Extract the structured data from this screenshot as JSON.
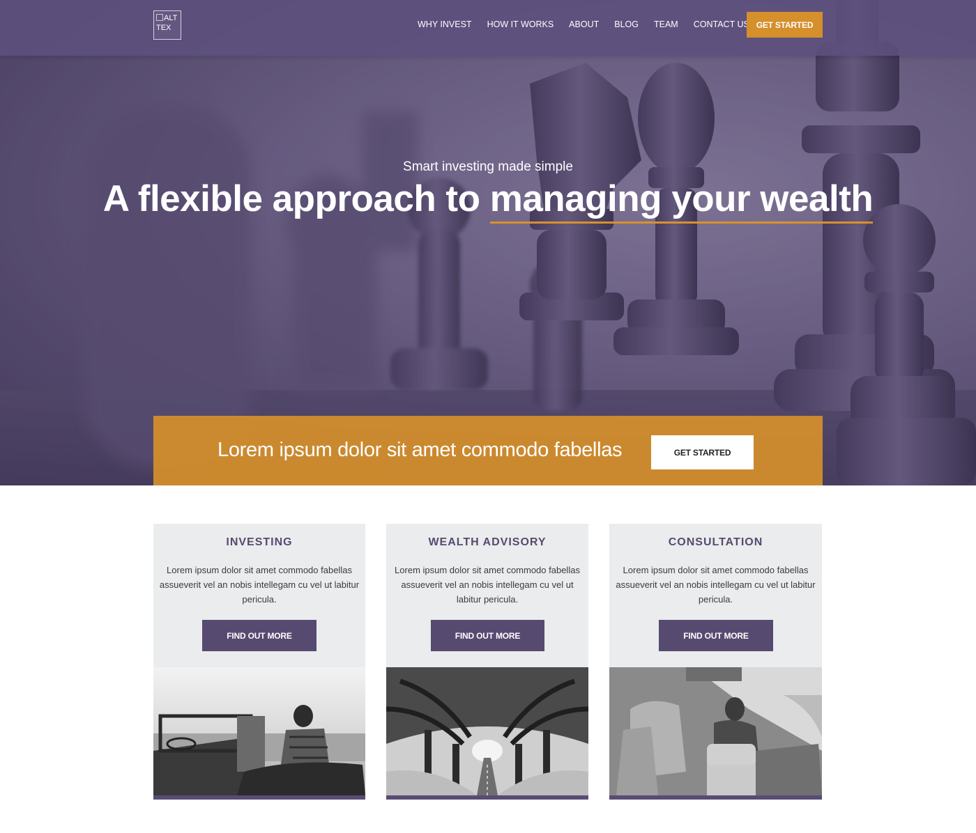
{
  "header": {
    "logo_alt": "ALT TEX",
    "nav": [
      "WHY INVEST",
      "HOW IT WORKS",
      "ABOUT",
      "BLOG",
      "TEAM",
      "CONTACT US"
    ],
    "cta": "GET STARTED"
  },
  "hero": {
    "subtitle": "Smart investing made simple",
    "title_lead": "A flexible approach to ",
    "title_highlight": "managing your wealth"
  },
  "banner": {
    "text": "Lorem ipsum dolor sit amet commodo fabellas",
    "button": "GET STARTED"
  },
  "cards": [
    {
      "title": "INVESTING",
      "body": "Lorem ipsum dolor sit amet commodo fabellas assueverit vel an nobis intellegam cu vel ut labitur pericula.",
      "button": "FIND OUT MORE",
      "image": "man-in-convertible-photo"
    },
    {
      "title": "WEALTH ADVISORY",
      "body": "Lorem ipsum dolor sit amet commodo fabellas assueverit vel an nobis intellegam cu vel ut labitur pericula.",
      "button": "FIND OUT MORE",
      "image": "tree-lined-road-photo"
    },
    {
      "title": "CONSULTATION",
      "body": "Lorem ipsum dolor sit amet commodo fabellas assueverit vel an nobis intellegam cu vel ut labitur pericula.",
      "button": "FIND OUT MORE",
      "image": "woman-in-car-photo"
    }
  ],
  "colors": {
    "purple": "#574a70",
    "gold": "#d58f2b",
    "card_bg": "#eaeced"
  }
}
